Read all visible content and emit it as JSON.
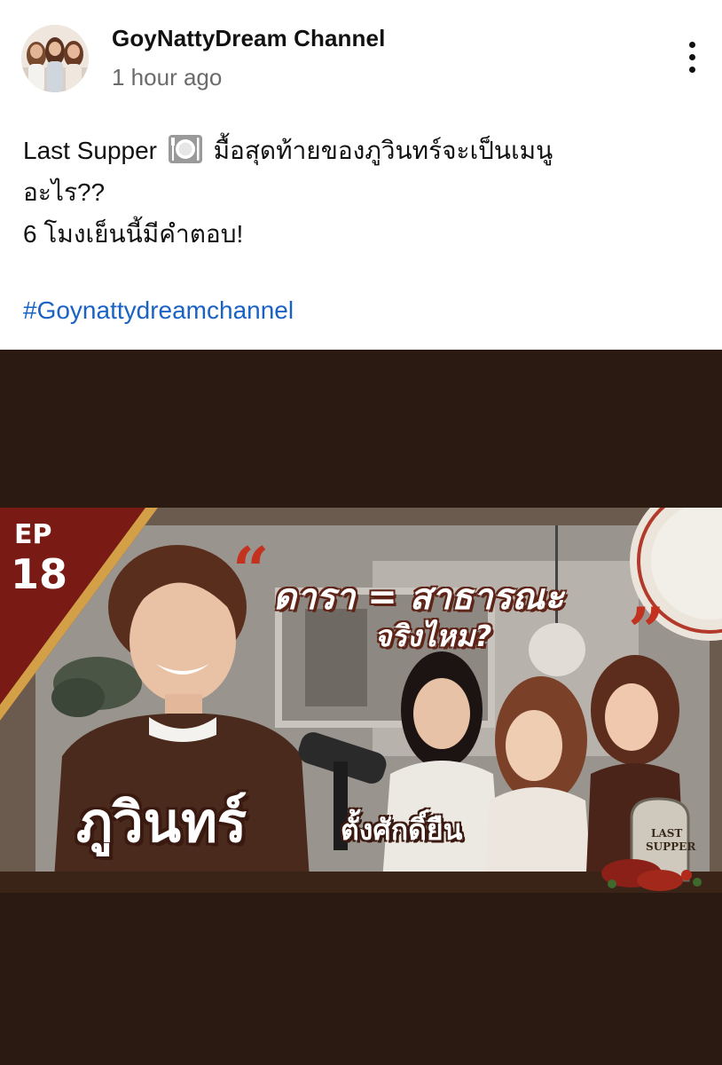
{
  "post": {
    "channel_name": "GoyNattyDream Channel",
    "timestamp": "1 hour ago",
    "text_line_1_a": "Last Supper",
    "text_line_1_b": "มื้อสุดท้ายของภูวินทร์จะเป็นเมนู",
    "text_line_2": "อะไร??",
    "text_line_3": "6 โมงเย็นนี้มีคำตอบ!",
    "hashtag": "#Goynattydreamchannel",
    "emoji_name": "plate-with-cutlery-icon"
  },
  "thumbnail": {
    "ep_label": "EP",
    "ep_number": "18",
    "quote_open": "“",
    "quote_close": "”",
    "headline": "ดารา = สาธารณะ",
    "subheadline": "จริงไหม?",
    "guest_name": "ภูวินทร์",
    "guest_tag": "ตั้งศักดิ์ยืน",
    "tomb_line_1": "LAST",
    "tomb_line_2": "SUPPER"
  },
  "colors": {
    "hashtag": "#1a62c4",
    "media_background": "#2b1a12",
    "banner_red": "#7a1a14",
    "accent_red": "#c2321f",
    "timestamp_gray": "#6b6b6b"
  }
}
